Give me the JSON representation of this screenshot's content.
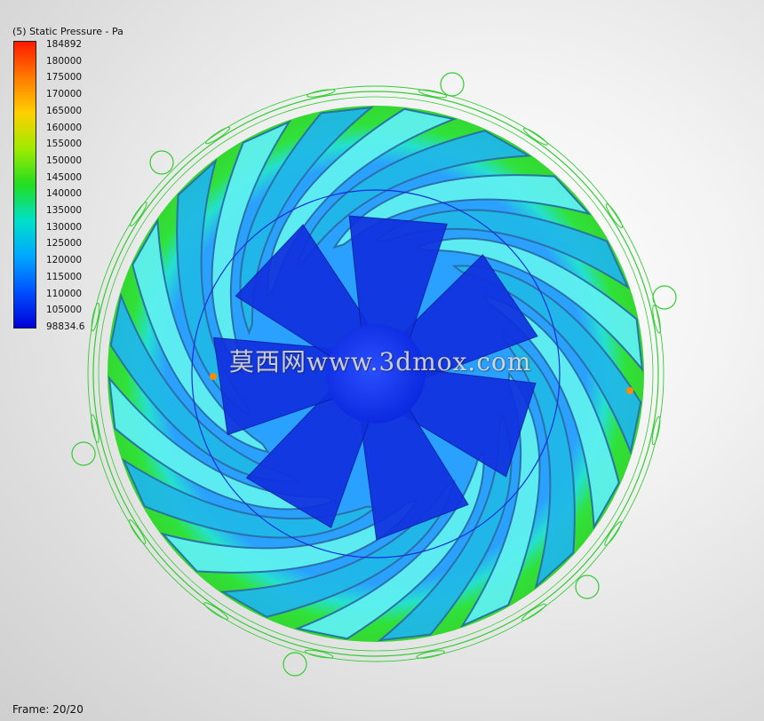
{
  "legend": {
    "title": "(5) Static Pressure - Pa",
    "ticks": [
      "184892",
      "180000",
      "175000",
      "170000",
      "165000",
      "160000",
      "155000",
      "150000",
      "145000",
      "140000",
      "135000",
      "130000",
      "125000",
      "120000",
      "115000",
      "110000",
      "105000",
      "98834.6"
    ],
    "max_value": 184892,
    "min_value": 98834.6,
    "colors": [
      "#ff1a00",
      "#ff7a00",
      "#ffd000",
      "#9eea00",
      "#22dd22",
      "#00e0c8",
      "#00a8ff",
      "#0050ff",
      "#0000d8"
    ]
  },
  "frame": {
    "label": "Frame: 20/20",
    "current": 20,
    "total": 20
  },
  "watermark": {
    "text": "莫西网www.3dmox.com"
  },
  "impeller": {
    "outer_blade_count": 20,
    "inner_blade_count": 7,
    "colors": {
      "rim": "#2fe23a",
      "blade_light": "#5ef0f0",
      "blade_mid": "#20b8e8",
      "blade_dark": "#2a6fa6",
      "inner_blade": "#1030e0",
      "hub": "#1238ff",
      "boundary_green": "#33cc33",
      "boundary_blue": "#1a2cd8"
    }
  }
}
